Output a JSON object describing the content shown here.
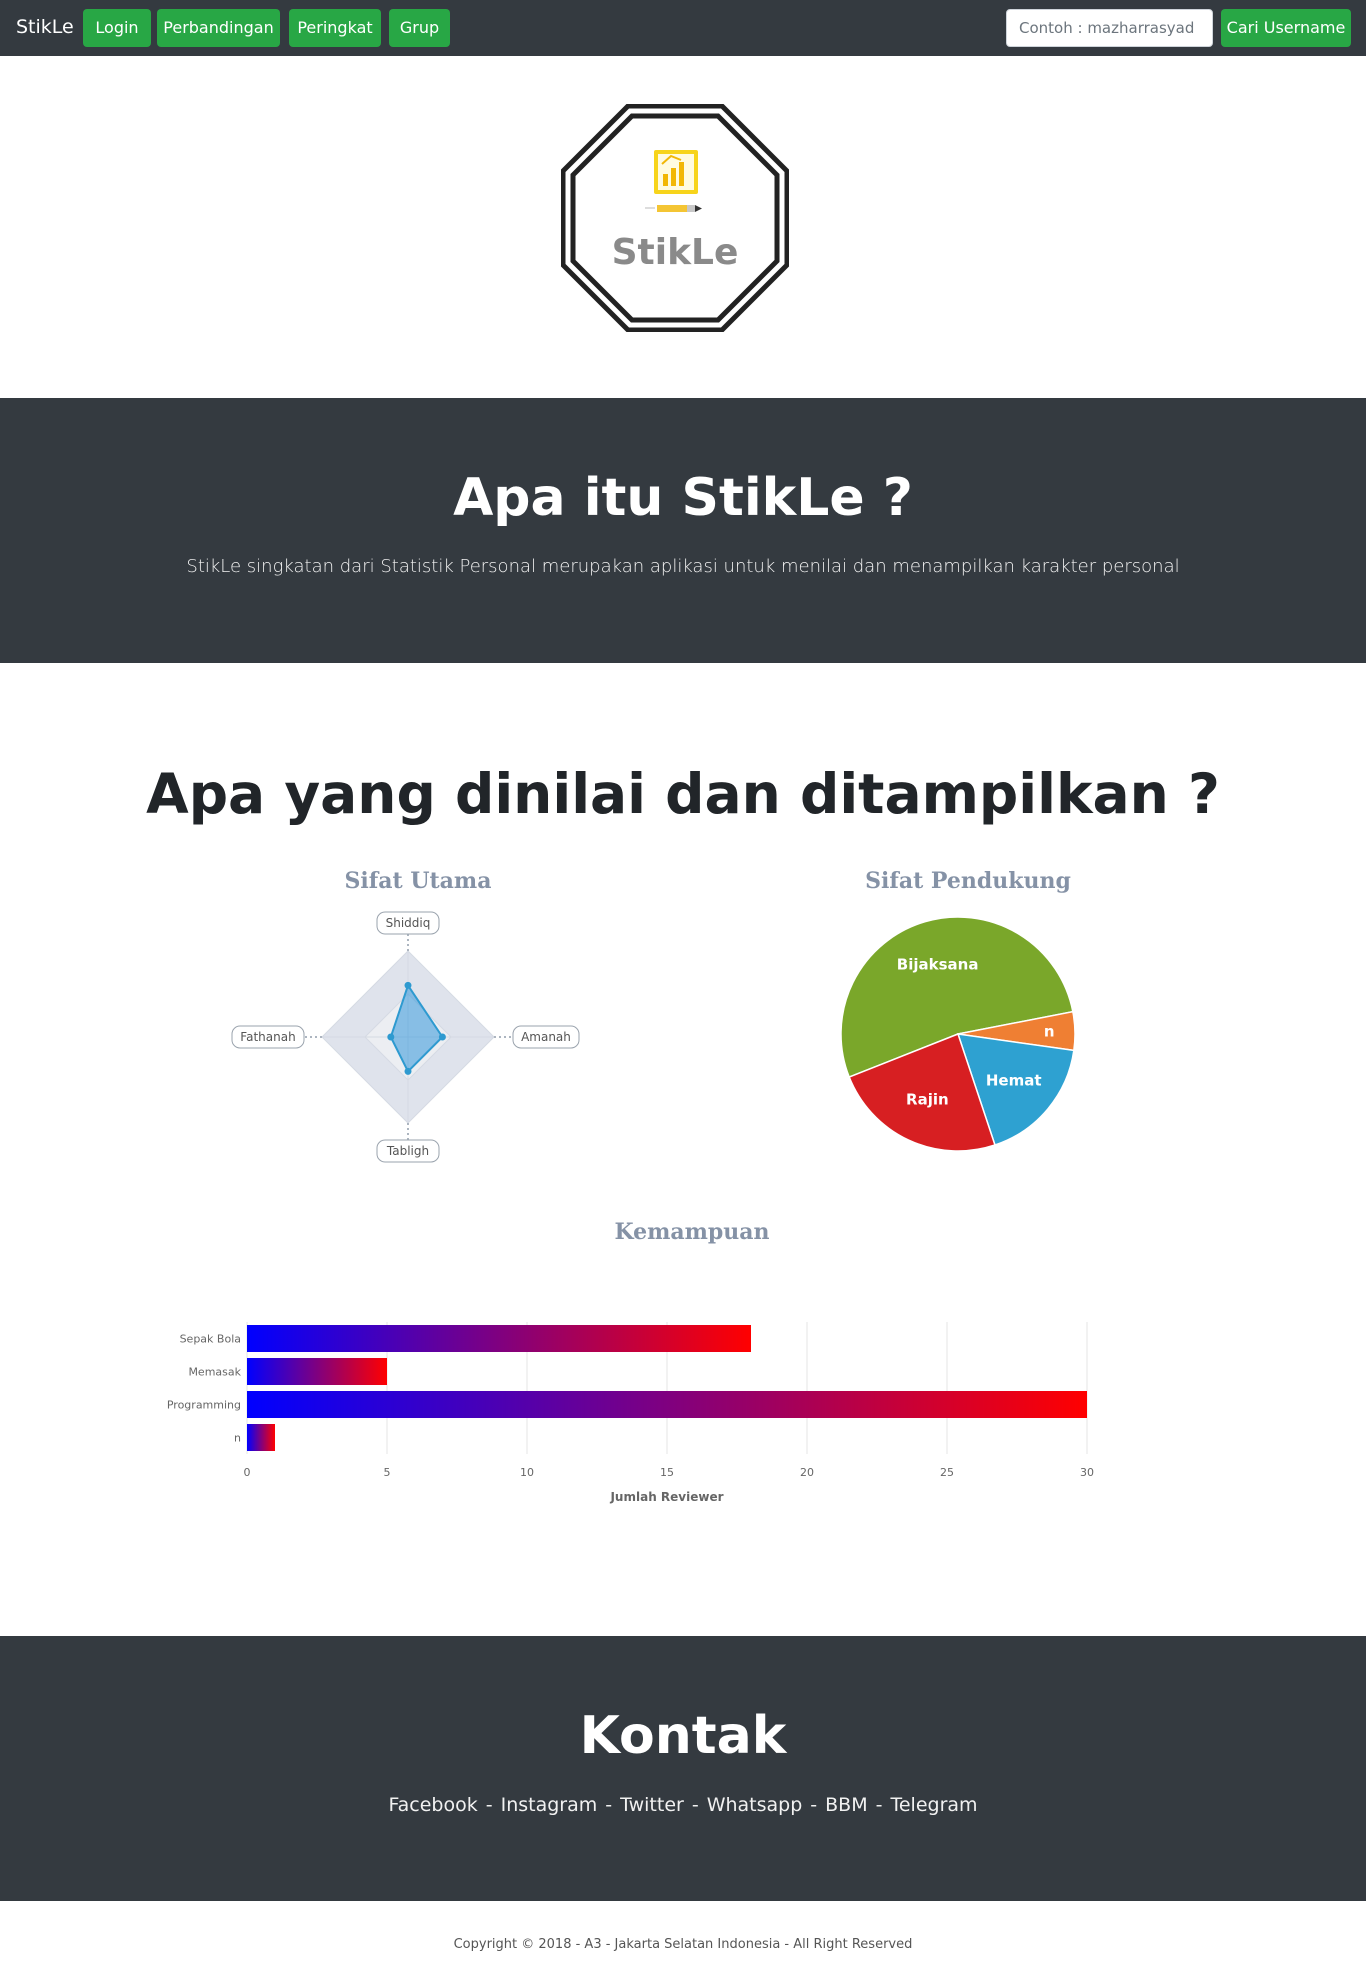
{
  "navbar": {
    "brand": "StikLe",
    "buttons": [
      "Login",
      "Perbandingan",
      "Peringkat",
      "Grup"
    ],
    "search_placeholder": "Contoh : mazharrasyad",
    "search_button": "Cari Username"
  },
  "logo": {
    "text": "StikLe"
  },
  "about": {
    "title": "Apa itu StikLe ?",
    "description": "StikLe singkatan dari Statistik Personal merupakan aplikasi untuk menilai dan menampilkan karakter personal"
  },
  "section": {
    "title": "Apa yang dinilai dan ditampilkan ?"
  },
  "colors": {
    "green": "#28a745",
    "dark": "#343a40",
    "chart_title": "#8592a6"
  },
  "chart_data": [
    {
      "type": "radar",
      "title": "Sifat Utama",
      "axes": [
        "Shiddiq",
        "Amanah",
        "Tabligh",
        "Fathanah"
      ],
      "values": [
        0.6,
        0.4,
        0.4,
        0.2
      ],
      "max": 1
    },
    {
      "type": "pie",
      "title": "Sifat Pendukung",
      "slices": [
        {
          "label": "Bijaksana",
          "value": 45,
          "color": "#7aa72a"
        },
        {
          "label": "n",
          "value": 4.5,
          "color": "#ef7f33"
        },
        {
          "label": "Hemat",
          "value": 15,
          "color": "#2ea1d1"
        },
        {
          "label": "Rajin",
          "value": 20.5,
          "color": "#d71f22"
        }
      ]
    },
    {
      "type": "bar",
      "orientation": "horizontal",
      "title": "Kemampuan",
      "categories": [
        "Sepak Bola",
        "Memasak",
        "Programming",
        "n"
      ],
      "values": [
        18,
        5,
        30,
        1
      ],
      "xlabel": "Jumlah Reviewer",
      "xlim": [
        0,
        30
      ],
      "xticks": [
        "0",
        "5",
        "10",
        "15",
        "20",
        "25",
        "30"
      ],
      "gradient": [
        "#0000ff",
        "#ff0000"
      ]
    }
  ],
  "contact": {
    "title": "Kontak",
    "links": [
      "Facebook",
      "Instagram",
      "Twitter",
      "Whatsapp",
      "BBM",
      "Telegram"
    ]
  },
  "footer": {
    "copyright": "Copyright © 2018 - A3 - Jakarta Selatan Indonesia - All Right Reserved"
  }
}
